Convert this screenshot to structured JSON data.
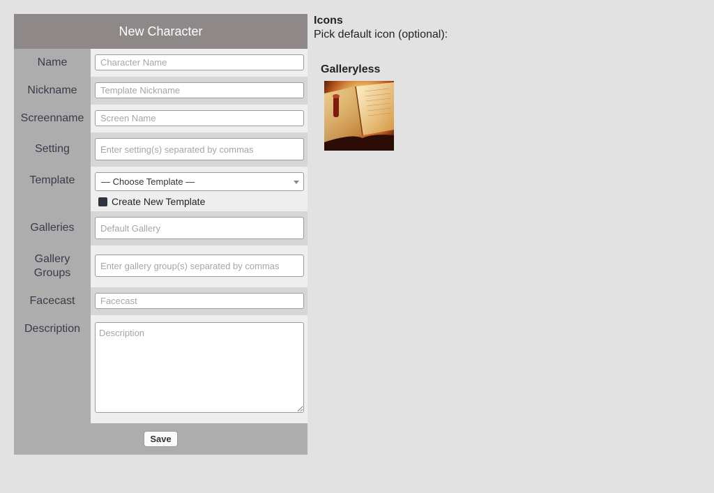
{
  "form": {
    "title": "New Character",
    "fields": {
      "name": {
        "label": "Name",
        "placeholder": "Character Name"
      },
      "nickname": {
        "label": "Nickname",
        "placeholder": "Template Nickname"
      },
      "screenname": {
        "label": "Screenname",
        "placeholder": "Screen Name"
      },
      "setting": {
        "label": "Setting",
        "placeholder": "Enter setting(s) separated by commas"
      },
      "template": {
        "label": "Template",
        "selected": "— Choose Template —",
        "create_new_label": "Create New Template"
      },
      "galleries": {
        "label": "Galleries",
        "placeholder": "Default Gallery"
      },
      "gallery_groups": {
        "label_line1": "Gallery",
        "label_line2": "Groups",
        "placeholder": "Enter gallery group(s) separated by commas"
      },
      "facecast": {
        "label": "Facecast",
        "placeholder": "Facecast"
      },
      "description": {
        "label": "Description",
        "placeholder": "Description"
      }
    },
    "save_label": "Save"
  },
  "icons": {
    "title": "Icons",
    "subtitle": "Pick default icon (optional):",
    "gallery_name": "Galleryless",
    "thumbnail": "open-book-icon"
  },
  "colors": {
    "header_bg": "#8e8988",
    "label_bg": "#adadad",
    "page_bg": "#e2e2e2"
  }
}
